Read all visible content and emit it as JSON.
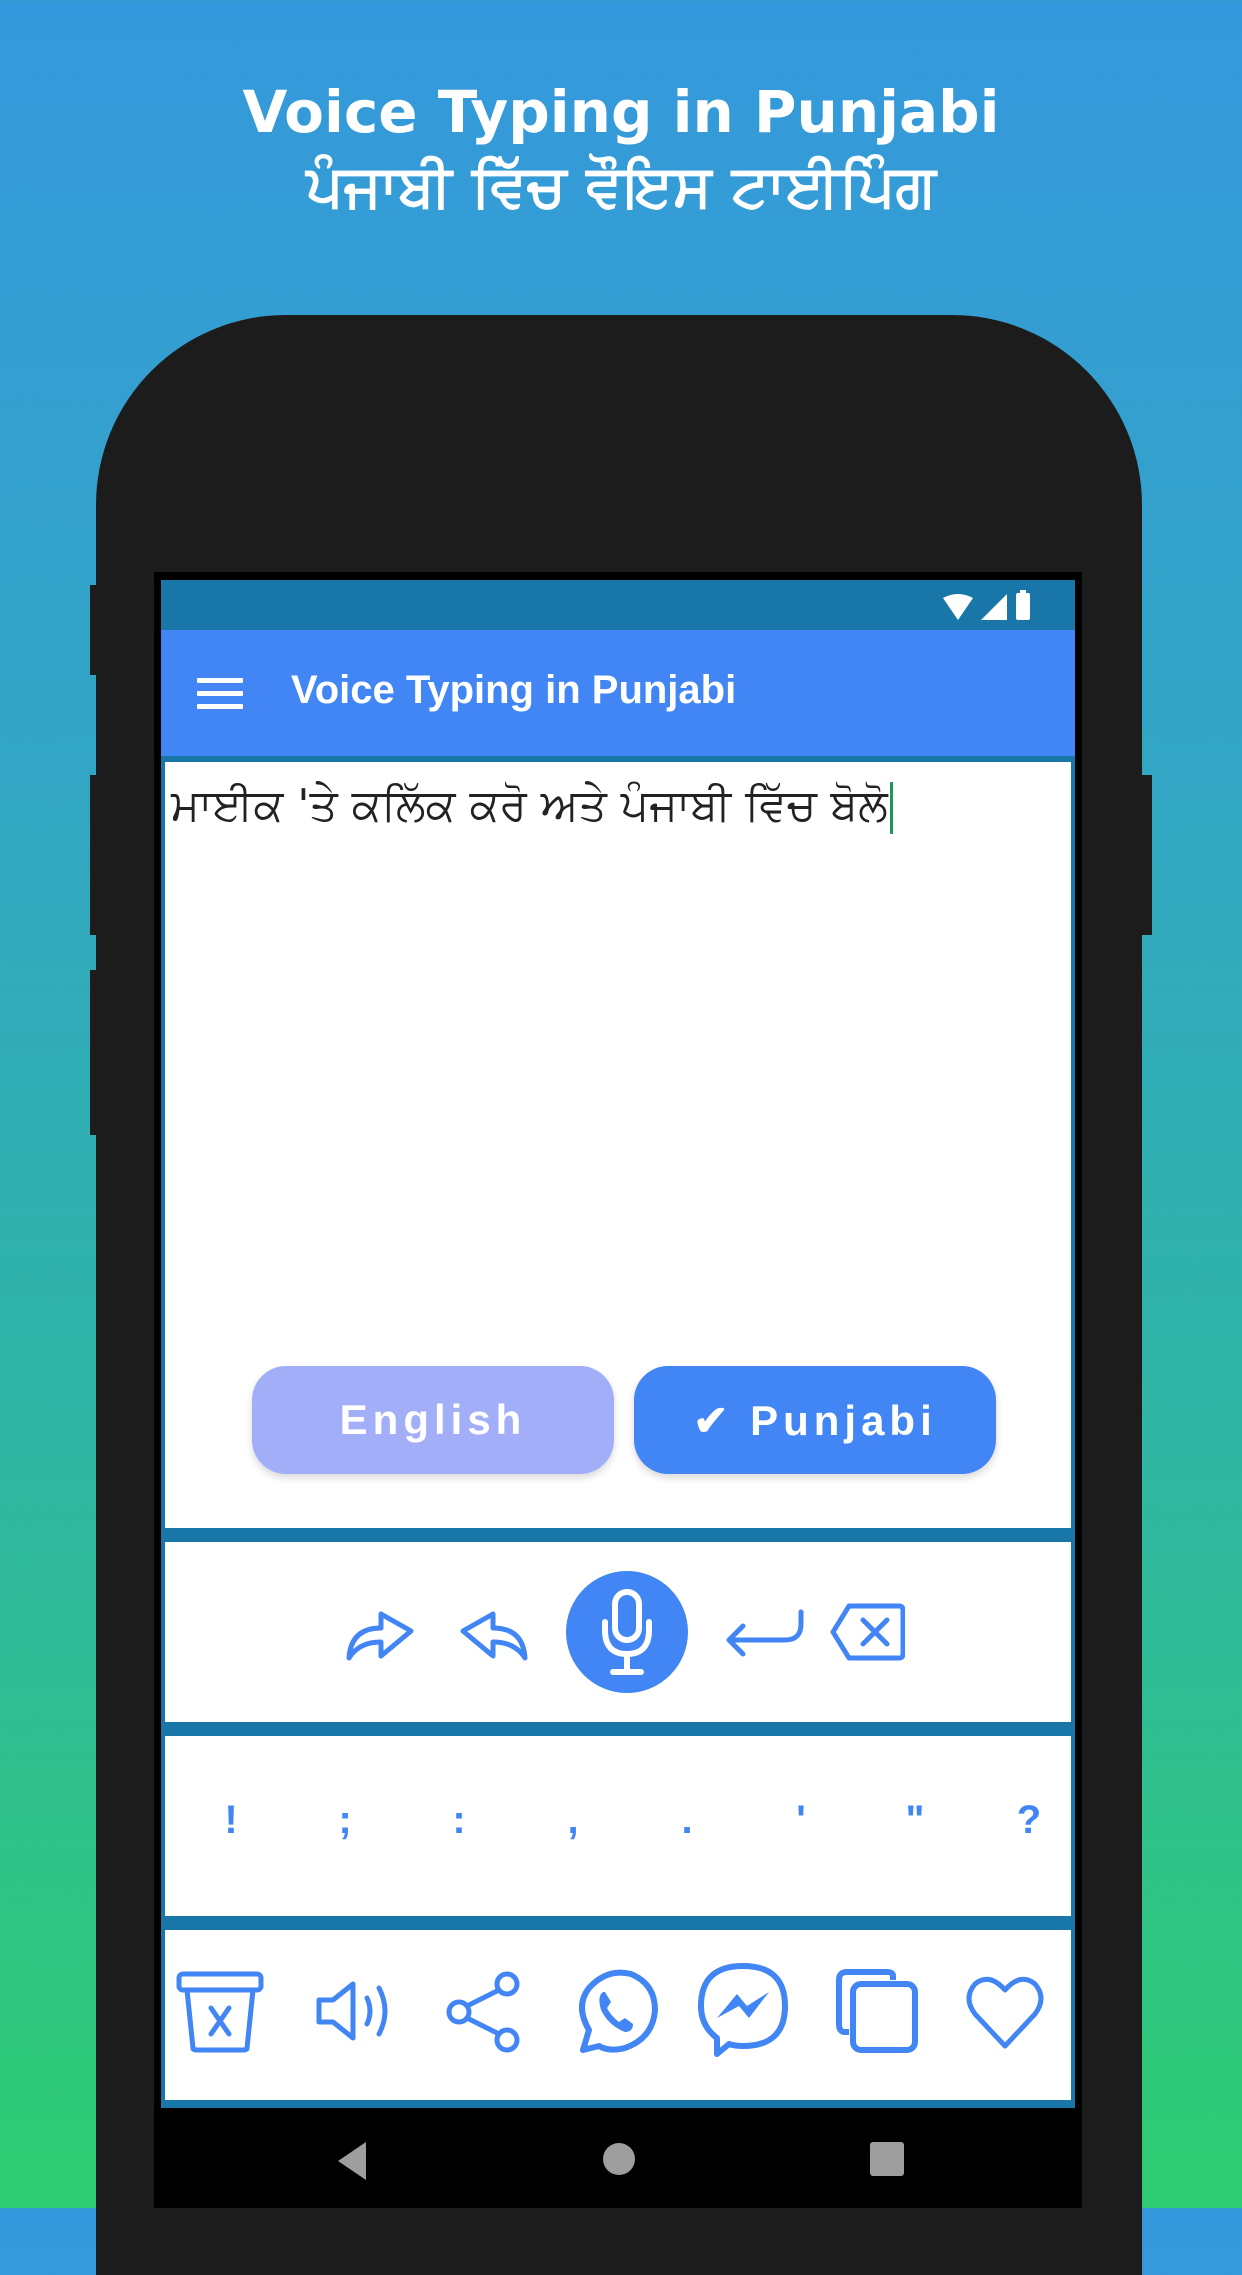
{
  "promo": {
    "title_en": "Voice Typing in Punjabi",
    "title_pa": "ਪੰਜਾਬੀ ਵਿੱਚ ਵੌਇਸ ਟਾਈਪਿੰਗ"
  },
  "status_bar": {
    "icons": [
      "wifi-icon",
      "signal-icon",
      "battery-icon"
    ]
  },
  "app_bar": {
    "title": "Voice Typing in Punjabi",
    "menu_icon": "hamburger-menu-icon"
  },
  "editor": {
    "text": "ਮਾਈਕ 'ਤੇ ਕਲਿੱਕ ਕਰੋ ਅਤੇ ਪੰਜਾਬੀ ਵਿੱਚ ਬੋਲੋ"
  },
  "language": {
    "english_label": "English",
    "punjabi_label": "✔ Punjabi",
    "selected": "Punjabi"
  },
  "toolbar": {
    "items": [
      "redo-icon",
      "undo-icon",
      "microphone-icon",
      "enter-icon",
      "backspace-icon"
    ]
  },
  "punctuation": {
    "keys": [
      "!",
      ";",
      ":",
      ",",
      ".",
      "'",
      "\"",
      "?"
    ]
  },
  "actions": {
    "items": [
      "clear-icon",
      "speaker-icon",
      "share-icon",
      "whatsapp-icon",
      "messenger-icon",
      "copy-icon",
      "favorite-icon"
    ]
  },
  "nav_bar": {
    "items": [
      "back-icon",
      "home-icon",
      "recents-icon"
    ]
  },
  "colors": {
    "accent": "#4285f4",
    "status_bar": "#1976a8",
    "english_inactive": "#a2aef8",
    "caret": "#1a9a5a",
    "gradient_top": "#3598dc",
    "gradient_bottom": "#2ecc71"
  }
}
